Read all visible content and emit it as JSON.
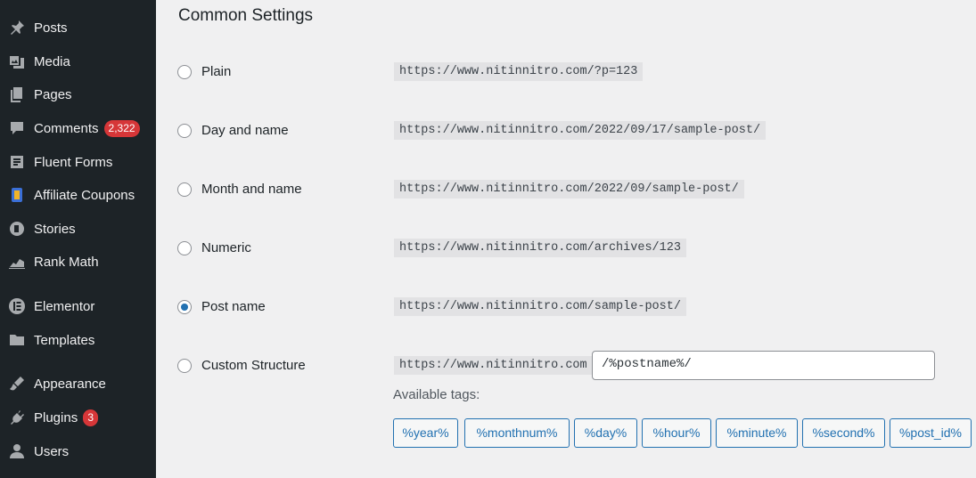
{
  "sidebar": {
    "items": [
      {
        "label": "Posts",
        "icon": "pin-icon"
      },
      {
        "label": "Media",
        "icon": "media-icon"
      },
      {
        "label": "Pages",
        "icon": "pages-icon"
      },
      {
        "label": "Comments",
        "icon": "comment-icon",
        "badge": "2,322"
      },
      {
        "label": "Fluent Forms",
        "icon": "forms-icon"
      },
      {
        "label": "Affiliate Coupons",
        "icon": "coupon-icon"
      },
      {
        "label": "Stories",
        "icon": "stories-icon"
      },
      {
        "label": "Rank Math",
        "icon": "chart-icon"
      },
      {
        "label": "Elementor",
        "icon": "elementor-icon"
      },
      {
        "label": "Templates",
        "icon": "folder-icon"
      },
      {
        "label": "Appearance",
        "icon": "brush-icon"
      },
      {
        "label": "Plugins",
        "icon": "plug-icon",
        "badge": "3"
      },
      {
        "label": "Users",
        "icon": "user-icon"
      }
    ]
  },
  "main": {
    "title": "Common Settings",
    "options": [
      {
        "label": "Plain",
        "code": "https://www.nitinnitro.com/?p=123",
        "checked": false
      },
      {
        "label": "Day and name",
        "code": "https://www.nitinnitro.com/2022/09/17/sample-post/",
        "checked": false
      },
      {
        "label": "Month and name",
        "code": "https://www.nitinnitro.com/2022/09/sample-post/",
        "checked": false
      },
      {
        "label": "Numeric",
        "code": "https://www.nitinnitro.com/archives/123",
        "checked": false
      },
      {
        "label": "Post name",
        "code": "https://www.nitinnitro.com/sample-post/",
        "checked": true
      },
      {
        "label": "Custom Structure",
        "code": "https://www.nitinnitro.com",
        "checked": false
      }
    ],
    "custom_value": "/%postname%/",
    "available_tags_label": "Available tags:",
    "tags": [
      "%year%",
      "%monthnum%",
      "%day%",
      "%hour%",
      "%minute%",
      "%second%",
      "%post_id%"
    ]
  },
  "colors": {
    "sidebar_bg": "#1d2327",
    "badge": "#d63638",
    "accent": "#2271b1",
    "content_bg": "#f0f0f1"
  }
}
